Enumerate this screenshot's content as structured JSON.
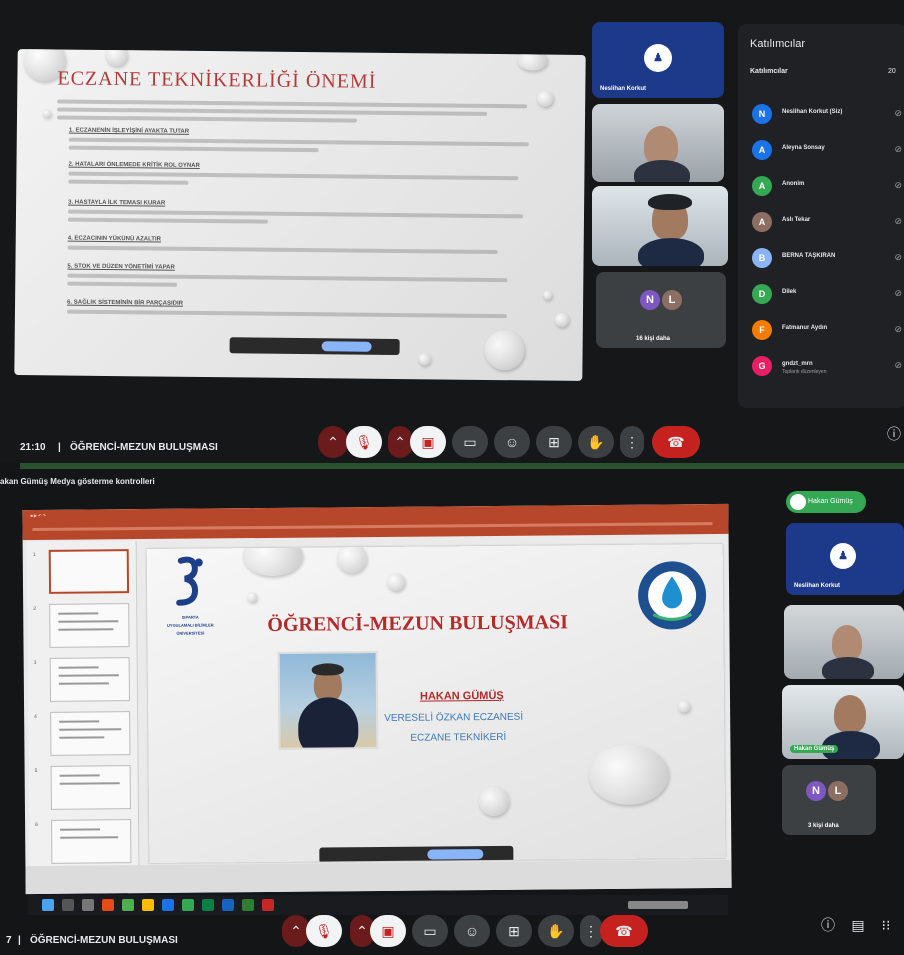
{
  "top": {
    "slide": {
      "title": "ECZANE TEKNİKERLİĞİ ÖNEMİ",
      "headings": [
        "1. ECZANENİN İŞLEYİŞİNİ AYAKTA TUTAR",
        "2. HATALARI ÖNLEMEDE KRİTİK ROL OYNAR",
        "3. HASTAYLA İLK TEMASI KURAR",
        "4. ECZACININ YÜKÜNÜ AZALTIR",
        "5. STOK VE DÜZEN YÖNETİMİ YAPAR",
        "6. SAĞLIK SİSTEMİNİN BİR PARÇASIDIR"
      ]
    },
    "tiles": [
      {
        "name": "Neslihan Korkut"
      },
      {
        "name": ""
      },
      {
        "name": ""
      },
      {
        "name": "16 kişi daha",
        "initials": [
          "N",
          "L"
        ]
      }
    ],
    "people_panel": {
      "title": "Katılımcılar",
      "subtitle": "Katılımcılar",
      "count": "20",
      "people": [
        {
          "name": "Neslihan Korkut (Siz)",
          "initial": "N",
          "color": "#1a73e8",
          "sub": ""
        },
        {
          "name": "Aleyna Sonsay",
          "initial": "A",
          "color": "#1a73e8",
          "sub": ""
        },
        {
          "name": "Anonim",
          "initial": "A",
          "color": "#34a853",
          "sub": ""
        },
        {
          "name": "Aslı Tekar",
          "initial": "A",
          "color": "#8d6e63",
          "sub": ""
        },
        {
          "name": "BERNA TAŞKIRAN",
          "initial": "B",
          "color": "#8ab4f8",
          "sub": ""
        },
        {
          "name": "Dilek",
          "initial": "D",
          "color": "#34a853",
          "sub": ""
        },
        {
          "name": "Fatmanur Aydın",
          "initial": "F",
          "color": "#f57c00",
          "sub": ""
        },
        {
          "name": "gndzt_mrn",
          "initial": "G",
          "color": "#e91e63",
          "sub": "Toplantı düzenleyen"
        }
      ]
    },
    "meeting": {
      "time": "21:10",
      "separator": "|",
      "name": "ÖĞRENCİ-MEZUN BULUŞMASI"
    },
    "controls": {
      "mic_icon": "mic-off-icon",
      "cam_icon": "cam-off-icon",
      "cc_icon": "captions-icon",
      "emoji_icon": "emoji-icon",
      "present_icon": "present-icon",
      "hand_icon": "raise-hand-icon",
      "more_icon": "more-icon",
      "leave_icon": "end-call-icon"
    }
  },
  "bottom": {
    "notice": "akan Gümüş Medya gösterme kontrolleri",
    "slide": {
      "title": "ÖĞRENCİ-MEZUN BULUŞMASI",
      "logo_line1": "ISPARTA",
      "logo_line2": "UYGULAMALI BİLİMLER",
      "logo_line3": "ÜNİVERSİTESİ",
      "person_name": "HAKAN GÜMÜŞ",
      "workplace": "VERESELİ ÖZKAN ECZANESİ",
      "role": "ECZANE TEKNİKERİ"
    },
    "share_pill": "Hakan Gümüş",
    "tiles": [
      {
        "name": "Neslihan Korkut"
      },
      {
        "name": ""
      },
      {
        "name": "Hakan Gümüş"
      },
      {
        "name": "3 kişi daha",
        "initials": [
          "N",
          "L"
        ]
      }
    ],
    "meeting": {
      "prefix": "7",
      "separator": "|",
      "name": "ÖĞRENCİ-MEZUN BULUŞMASI"
    },
    "colors": {
      "accent_red": "#c5221f",
      "meet_blue": "#1a73e8",
      "ppt_orange": "#b7472a",
      "slide_red": "#b32a2a"
    }
  }
}
